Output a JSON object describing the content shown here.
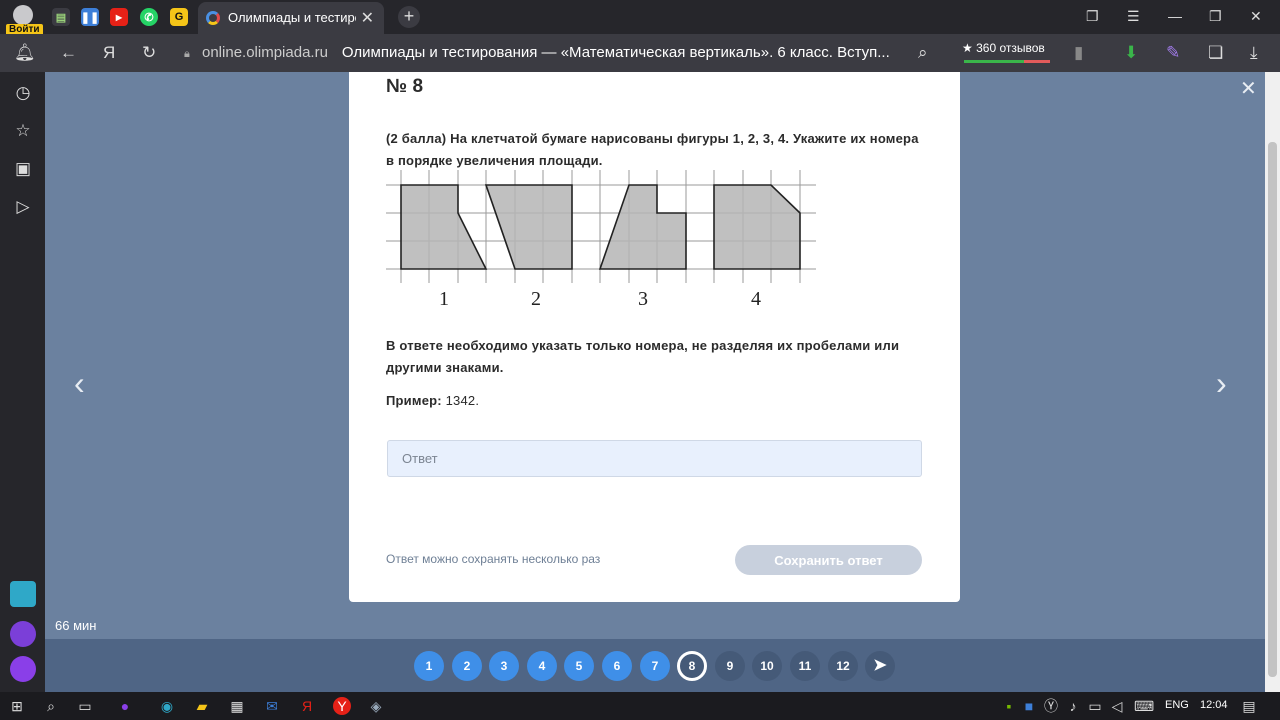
{
  "browser": {
    "profile_label": "Войти",
    "active_tab_title": "Олимпиады и тестирование",
    "url_domain": "online.olimpiada.ru",
    "page_title": "Олимпиады и тестирования — «Математическая вертикаль». 6 класс. Вступ...",
    "reviews": "360 отзывов"
  },
  "task": {
    "number": "№ 8",
    "question": "(2 балла) На клетчатой бумаге нарисованы фигуры 1, 2, 3, 4. Укажите их номера в порядке увеличения площади.",
    "note": "В ответе необходимо указать только номера, не разделяя их пробелами или другими знаками.",
    "example_label": "Пример:",
    "example_value": "1342.",
    "answer_placeholder": "Ответ",
    "save_hint": "Ответ можно сохранять несколько раз",
    "save_label": "Сохранить ответ",
    "figure_labels": [
      "1",
      "2",
      "3",
      "4"
    ]
  },
  "timer": "66 мин",
  "pages": [
    {
      "label": "1",
      "state": "done"
    },
    {
      "label": "2",
      "state": "done"
    },
    {
      "label": "3",
      "state": "done"
    },
    {
      "label": "4",
      "state": "done"
    },
    {
      "label": "5",
      "state": "done"
    },
    {
      "label": "6",
      "state": "done"
    },
    {
      "label": "7",
      "state": "done"
    },
    {
      "label": "8",
      "state": "current"
    },
    {
      "label": "9",
      "state": "todo"
    },
    {
      "label": "10",
      "state": "todo"
    },
    {
      "label": "11",
      "state": "todo"
    },
    {
      "label": "12",
      "state": "todo"
    }
  ],
  "taskbar": {
    "lang": "ENG",
    "time": "12:04"
  },
  "colors": {
    "page_bg": "#6b819f",
    "page_done": "#3f8fe8",
    "figure_fill": "#b5b5b5"
  }
}
